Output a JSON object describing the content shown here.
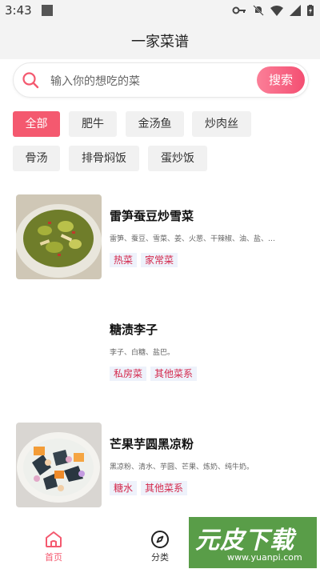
{
  "status_bar": {
    "time": "3:43"
  },
  "header": {
    "title": "一家菜谱"
  },
  "search": {
    "placeholder": "输入你的想吃的菜",
    "button_label": "搜索"
  },
  "tags": [
    {
      "label": "全部",
      "active": true
    },
    {
      "label": "肥牛"
    },
    {
      "label": "金汤鱼"
    },
    {
      "label": "炒肉丝"
    },
    {
      "label": "骨汤"
    },
    {
      "label": "排骨焖饭"
    },
    {
      "label": "蛋炒饭"
    }
  ],
  "recipes": [
    {
      "title": "雷笋蚕豆炒雪菜",
      "ingredients": "雷笋、蚕豆、雪菜、姜、火葱、干辣椒、油、盐、…",
      "tags": [
        "热菜",
        "家常菜"
      ],
      "has_image": true
    },
    {
      "title": "糖渍李子",
      "ingredients": "李子、白糖、盐巴。",
      "tags": [
        "私房菜",
        "其他菜系"
      ],
      "has_image": false
    },
    {
      "title": "芒果芋圆黑凉粉",
      "ingredients": "黑凉粉、清水、芋圆、芒果、炼奶、纯牛奶。",
      "tags": [
        "糖水",
        "其他菜系"
      ],
      "has_image": true
    }
  ],
  "bottom_nav": {
    "home_label": "首页",
    "category_label": "分类"
  },
  "watermark": {
    "text": "元皮下载",
    "url": "www.yuanpi.com"
  },
  "colors": {
    "accent": "#f4596f",
    "tag_text": "#d4284c"
  }
}
